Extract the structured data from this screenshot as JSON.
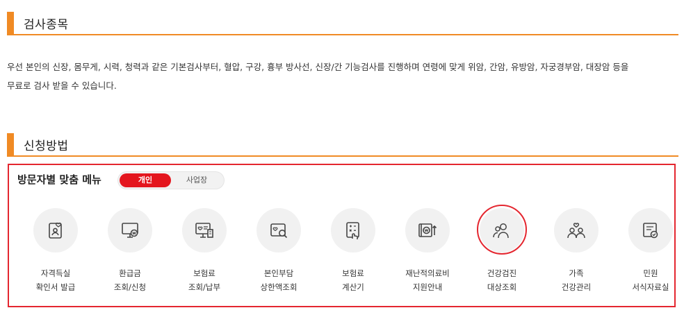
{
  "section1": {
    "title": "검사종목"
  },
  "description": {
    "line1": "우선 본인의 신장, 몸무게, 시력, 청력과 같은 기본검사부터, 혈압, 구강, 흉부 방사선, 신장/간 기능검사를 진행하며 연령에 맞게 위암, 간암, 유방암, 자궁경부암, 대장암 등을",
    "line2": "무료로 검사 받을 수 있습니다."
  },
  "section2": {
    "title": "신청방법"
  },
  "menu": {
    "title": "방문자별 맞춤 메뉴",
    "toggle": {
      "active": "개인",
      "inactive": "사업장"
    },
    "items": [
      {
        "line1": "자격득실",
        "line2": "확인서 발급",
        "icon": "id-card-heart-icon"
      },
      {
        "line1": "환급금",
        "line2": "조회/신청",
        "icon": "monitor-won-icon"
      },
      {
        "line1": "보험료",
        "line2": "조회/납부",
        "icon": "bill-monitor-icon"
      },
      {
        "line1": "본인부담",
        "line2": "상한액조회",
        "icon": "card-search-icon"
      },
      {
        "line1": "보험료",
        "line2": "계산기",
        "icon": "calculator-hand-icon"
      },
      {
        "line1": "재난적의료비",
        "line2": "지원안내",
        "icon": "wallet-won-icon"
      },
      {
        "line1": "건강검진",
        "line2": "대상조회",
        "icon": "people-search-icon"
      },
      {
        "line1": "가족",
        "line2": "건강관리",
        "icon": "family-heart-icon"
      },
      {
        "line1": "민원",
        "line2": "서식자료실",
        "icon": "document-check-icon"
      }
    ]
  },
  "colors": {
    "accent_orange": "#f08a24",
    "highlight_red": "#e4262f",
    "toggle_red": "#e4161e"
  }
}
